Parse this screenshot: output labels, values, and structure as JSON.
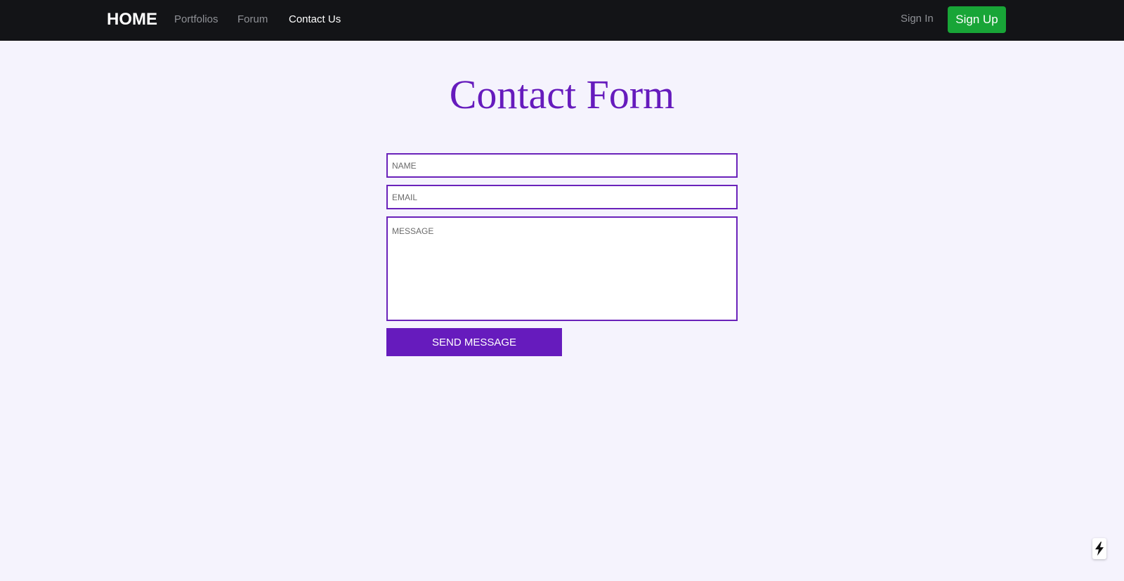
{
  "nav": {
    "brand": "HOME",
    "links": [
      {
        "label": "Portfolios"
      },
      {
        "label": "Forum"
      },
      {
        "label": "Contact Us",
        "active": true
      }
    ],
    "sign_in": "Sign In",
    "sign_up": "Sign Up"
  },
  "main": {
    "title": "Contact Form",
    "form": {
      "name_placeholder": "NAME",
      "email_placeholder": "EMAIL",
      "message_placeholder": "MESSAGE",
      "name_value": "",
      "email_value": "",
      "message_value": "",
      "submit_label": "SEND MESSAGE"
    }
  },
  "widget": {
    "icon": "lightning-bolt-icon"
  },
  "colors": {
    "navbar_bg": "#131417",
    "page_bg": "#f5f3fd",
    "accent_purple": "#661bbd",
    "signup_green": "#18a537"
  }
}
